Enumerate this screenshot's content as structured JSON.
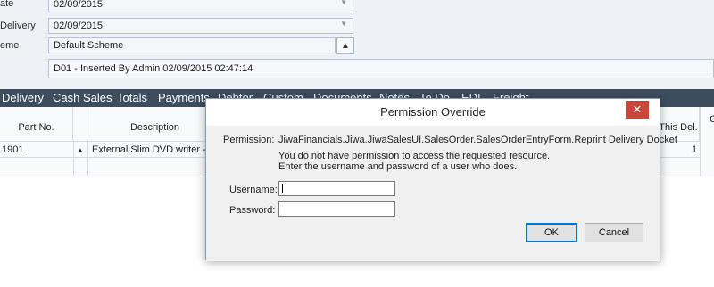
{
  "header": {
    "rows": [
      {
        "label": "ate",
        "value": "02/09/2015"
      },
      {
        "label": "Delivery",
        "value": "02/09/2015"
      }
    ],
    "scheme": {
      "label": "eme",
      "value": "Default Scheme"
    },
    "note": "D01 - Inserted By Admin 02/09/2015 02:47:14"
  },
  "tabs": [
    "Delivery",
    "Cash Sales",
    "Totals",
    "Payments",
    "Debtor",
    "Custom",
    "Documents",
    "Notes",
    "To Do",
    "EDI",
    "Freight"
  ],
  "grid": {
    "columns": {
      "part_no": "Part No.",
      "description": "Description",
      "this_del": "This Del.",
      "extra": "C"
    },
    "row": {
      "part_no": "1901",
      "description": "External Slim DVD writer - DR",
      "this_del": "1"
    }
  },
  "dialog": {
    "title": "Permission Override",
    "close_icon": "✕",
    "permission_label": "Permission:",
    "permission_value": "JiwaFinancials.Jiwa.JiwaSalesUI.SalesOrder.SalesOrderEntryForm.Reprint Delivery Docket",
    "message_line1": "You do not have permission to access the requested resource.",
    "message_line2": "Enter the username and password of a user who does.",
    "username_label": "Username:",
    "password_label": "Password:",
    "username_value": "",
    "password_value": "",
    "ok_label": "OK",
    "cancel_label": "Cancel"
  }
}
